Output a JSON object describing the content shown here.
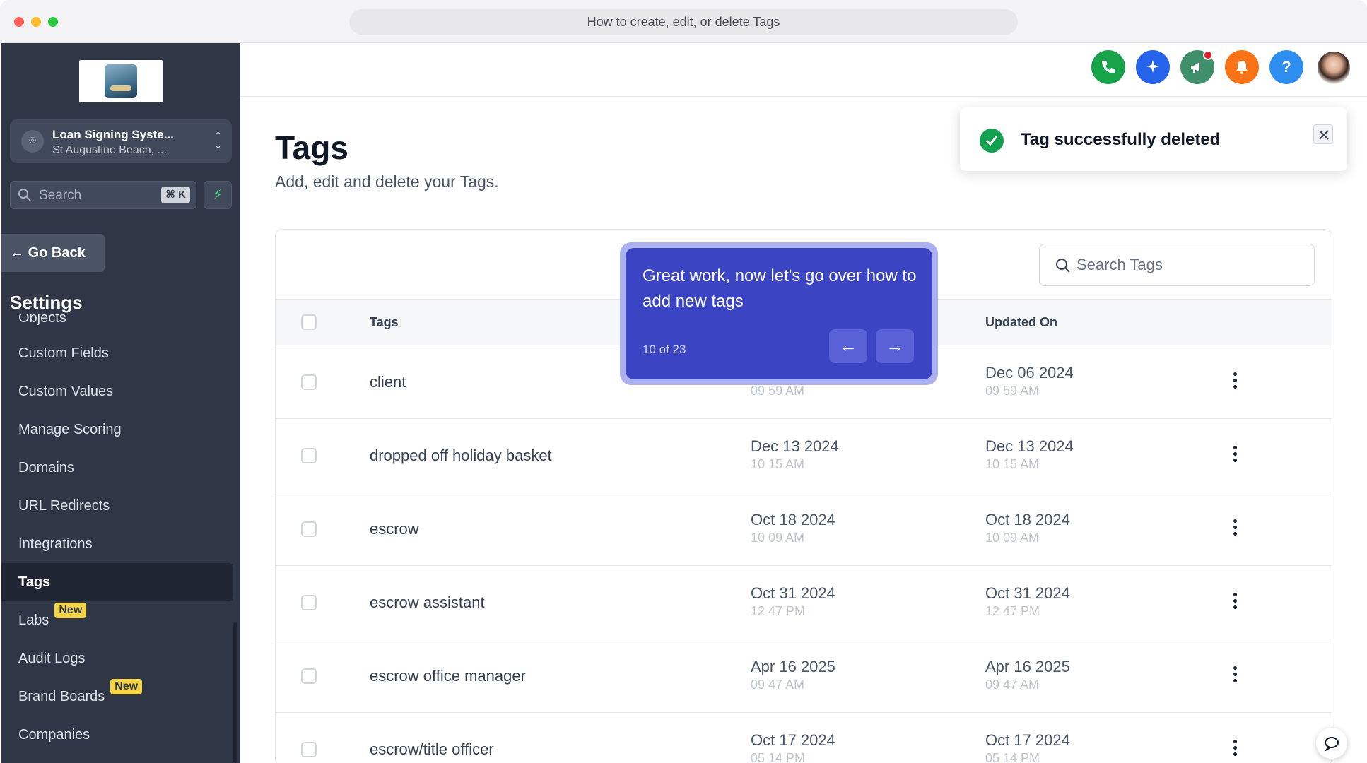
{
  "browser": {
    "url_title": "How to create, edit, or delete Tags"
  },
  "sidebar": {
    "account_name": "Loan Signing Syste...",
    "account_location": "St Augustine Beach, ...",
    "search_placeholder": "Search",
    "search_shortcut": "⌘ K",
    "go_back": "Go Back",
    "section_title": "Settings",
    "items": [
      {
        "label": "Objects",
        "badge": ""
      },
      {
        "label": "Custom Fields",
        "badge": ""
      },
      {
        "label": "Custom Values",
        "badge": ""
      },
      {
        "label": "Manage Scoring",
        "badge": ""
      },
      {
        "label": "Domains",
        "badge": ""
      },
      {
        "label": "URL Redirects",
        "badge": ""
      },
      {
        "label": "Integrations",
        "badge": ""
      },
      {
        "label": "Tags",
        "badge": ""
      },
      {
        "label": "Labs",
        "badge": "New"
      },
      {
        "label": "Audit Logs",
        "badge": ""
      },
      {
        "label": "Brand Boards",
        "badge": "New"
      },
      {
        "label": "Companies",
        "badge": ""
      }
    ],
    "active_item": "Tags"
  },
  "topbar": {
    "buttons": [
      {
        "icon": "phone-icon",
        "color": "#17a34a"
      },
      {
        "icon": "sparkle-icon",
        "color": "#2563eb"
      },
      {
        "icon": "megaphone-icon",
        "color": "#3f8f6b"
      },
      {
        "icon": "bell-icon",
        "color": "#f97316"
      },
      {
        "icon": "help-icon",
        "color": "#2f8ff0",
        "glyph": "?"
      }
    ]
  },
  "main": {
    "title": "Tags",
    "subtitle": "Add, edit and delete your Tags.",
    "search_placeholder": "Search Tags",
    "columns": {
      "tags": "Tags",
      "updated_on": "Updated On"
    },
    "rows": [
      {
        "name": "client",
        "created_date": "",
        "created_time": "09 59 AM",
        "updated_date": "Dec 06 2024",
        "updated_time": "09 59 AM"
      },
      {
        "name": "dropped off holiday basket",
        "created_date": "Dec 13 2024",
        "created_time": "10 15 AM",
        "updated_date": "Dec 13 2024",
        "updated_time": "10 15 AM"
      },
      {
        "name": "escrow",
        "created_date": "Oct 18 2024",
        "created_time": "10 09 AM",
        "updated_date": "Oct 18 2024",
        "updated_time": "10 09 AM"
      },
      {
        "name": "escrow assistant",
        "created_date": "Oct 31 2024",
        "created_time": "12 47 PM",
        "updated_date": "Oct 31 2024",
        "updated_time": "12 47 PM"
      },
      {
        "name": "escrow office manager",
        "created_date": "Apr 16 2025",
        "created_time": "09 47 AM",
        "updated_date": "Apr 16 2025",
        "updated_time": "09 47 AM"
      },
      {
        "name": "escrow/title officer",
        "created_date": "Oct 17 2024",
        "created_time": "05 14 PM",
        "updated_date": "Oct 17 2024",
        "updated_time": "05 14 PM"
      }
    ]
  },
  "tour": {
    "message": "Great work, now let's go over how to add new tags",
    "progress": "10 of 23",
    "prev_glyph": "←",
    "next_glyph": "→"
  },
  "toast": {
    "message": "Tag successfully deleted"
  },
  "colors": {
    "sidebar_bg": "#2f3746",
    "tour_bg": "#3b45c4",
    "success": "#12a150",
    "badge": "#f5d547"
  }
}
